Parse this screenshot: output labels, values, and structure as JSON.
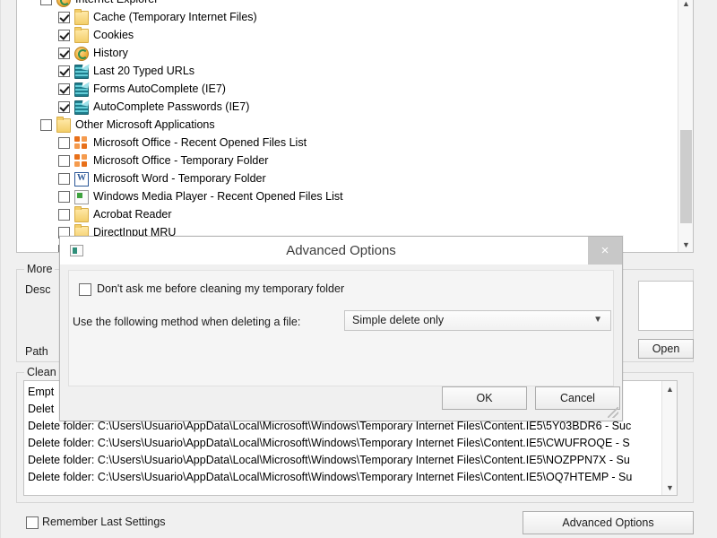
{
  "window": {
    "tree": {
      "items": [
        {
          "label": "Internet Explorer",
          "checked": false,
          "icon": "ie-globe-icon",
          "indent": 0,
          "clipped_top": true
        },
        {
          "label": "Cache (Temporary Internet Files)",
          "checked": true,
          "icon": "folder-icon",
          "indent": 1
        },
        {
          "label": "Cookies",
          "checked": true,
          "icon": "folder-icon",
          "indent": 1
        },
        {
          "label": "History",
          "checked": true,
          "icon": "history-icon",
          "indent": 1
        },
        {
          "label": "Last 20 Typed URLs",
          "checked": true,
          "icon": "url-list-icon",
          "indent": 1
        },
        {
          "label": "Forms AutoComplete (IE7)",
          "checked": true,
          "icon": "url-list-icon",
          "indent": 1
        },
        {
          "label": "AutoComplete Passwords  (IE7)",
          "checked": true,
          "icon": "url-list-icon",
          "indent": 1
        },
        {
          "label": "Other Microsoft Applications",
          "checked": false,
          "icon": "folder-icon",
          "indent": 0
        },
        {
          "label": "Microsoft Office - Recent Opened Files List",
          "checked": false,
          "icon": "office-icon",
          "indent": 1
        },
        {
          "label": "Microsoft Office - Temporary Folder",
          "checked": false,
          "icon": "office-icon",
          "indent": 1
        },
        {
          "label": "Microsoft Word - Temporary Folder",
          "checked": false,
          "icon": "word-icon",
          "indent": 1
        },
        {
          "label": "Windows Media Player - Recent Opened Files List",
          "checked": false,
          "icon": "media-player-icon",
          "indent": 1
        },
        {
          "label": "Acrobat Reader",
          "checked": false,
          "icon": "folder-icon",
          "indent": 1
        },
        {
          "label": "DirectInput MRU",
          "checked": false,
          "icon": "folder-icon",
          "indent": 1
        },
        {
          "label": "",
          "checked": false,
          "icon": "none",
          "indent": 1
        }
      ],
      "scrollbar": {
        "up_arrow": "chevron-up-icon",
        "down_arrow": "chevron-down-icon"
      }
    },
    "more_group": {
      "caption": "More"
    },
    "desc_label": "Desc",
    "path_label": "Path",
    "path_value": "",
    "open_button": "Open",
    "clean_group": {
      "caption": "Clean"
    },
    "log": {
      "lines": [
        "Empt",
        "Delet",
        "Delete folder: C:\\Users\\Usuario\\AppData\\Local\\Microsoft\\Windows\\Temporary Internet Files\\Content.IE5\\5Y03BDR6  - Suc",
        "Delete folder: C:\\Users\\Usuario\\AppData\\Local\\Microsoft\\Windows\\Temporary Internet Files\\Content.IE5\\CWUFROQE  - S",
        "Delete folder: C:\\Users\\Usuario\\AppData\\Local\\Microsoft\\Windows\\Temporary Internet Files\\Content.IE5\\NOZPPN7X  - Su",
        "Delete folder: C:\\Users\\Usuario\\AppData\\Local\\Microsoft\\Windows\\Temporary Internet Files\\Content.IE5\\OQ7HTEMP  - Su"
      ],
      "scrollbar": {
        "up_arrow": "chevron-up-icon",
        "down_arrow": "chevron-down-icon"
      }
    },
    "footer": {
      "remember_label": "Remember Last Settings",
      "remember_checked": false,
      "advanced_button": "Advanced Options"
    }
  },
  "dialog": {
    "title": "Advanced Options",
    "icon": "app-icon",
    "close_glyph": "×",
    "dont_ask": {
      "label": "Don't ask me before cleaning my temporary folder",
      "checked": false
    },
    "method_label": "Use the following method when deleting a file:",
    "method_value": "Simple delete only",
    "method_arrow": "⌄",
    "ok_button": "OK",
    "cancel_button": "Cancel"
  },
  "colors": {
    "window_bg": "#f0f0f0",
    "list_bg": "#ffffff",
    "border": "#c0c0c0",
    "dialog_title_bg": "#ffffff",
    "close_btn_bg": "#c8c8c8",
    "scroll_thumb": "#cdcdcd"
  }
}
